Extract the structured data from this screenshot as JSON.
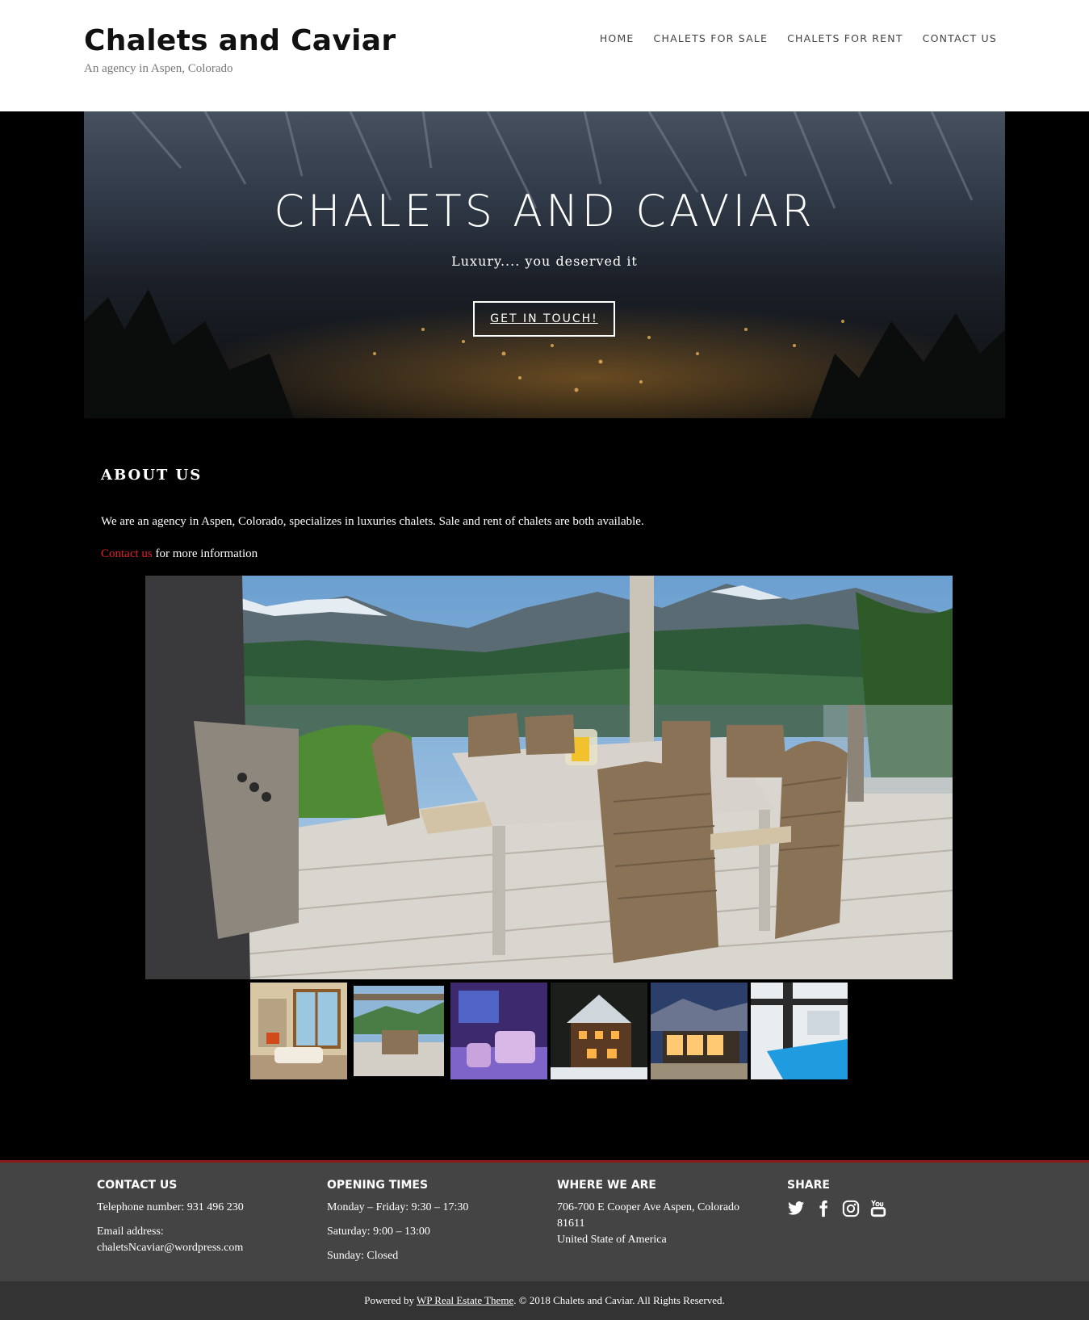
{
  "header": {
    "site_title": "Chalets and Caviar",
    "tagline": "An agency in Aspen, Colorado",
    "nav": [
      {
        "label": "HOME"
      },
      {
        "label": "CHALETS FOR SALE"
      },
      {
        "label": "CHALETS FOR RENT"
      },
      {
        "label": "CONTACT US"
      }
    ]
  },
  "hero": {
    "title": "CHALETS AND CAVIAR",
    "subtitle": "Luxury.... you deserved it",
    "button_label": "GET IN TOUCH!"
  },
  "about": {
    "heading": "ABOUT US",
    "text": "We are an agency in Aspen, Colorado, specializes in luxuries chalets. Sale and rent of chalets are both available.",
    "contact_link": "Contact us",
    "contact_suffix": " for more information"
  },
  "footer": {
    "contact": {
      "heading": "CONTACT US",
      "telephone": "Telephone number: 931 496 230",
      "email_label": "Email address:",
      "email": "chaletsNcaviar@wordpress.com"
    },
    "hours": {
      "heading": "OPENING TIMES",
      "weekdays": "Monday – Friday: 9:30 – 17:30",
      "saturday": "Saturday: 9:00 – 13:00",
      "sunday": "Sunday: Closed"
    },
    "location": {
      "heading": "WHERE WE ARE",
      "address1": "706-700 E Cooper Ave Aspen, Colorado",
      "address2": "81611",
      "country": "United State of America"
    },
    "share": {
      "heading": "SHARE",
      "icons": [
        "twitter-icon",
        "facebook-icon",
        "instagram-icon",
        "youtube-icon"
      ]
    }
  },
  "bottom_bar": {
    "prefix": "Powered by ",
    "link": "WP Real Estate Theme",
    "suffix": ". © 2018 Chalets and Caviar. All Rights Reserved."
  },
  "colors": {
    "link_red": "#e0202a",
    "footer_bg": "#444444",
    "footer_border": "#8b1a1a"
  }
}
